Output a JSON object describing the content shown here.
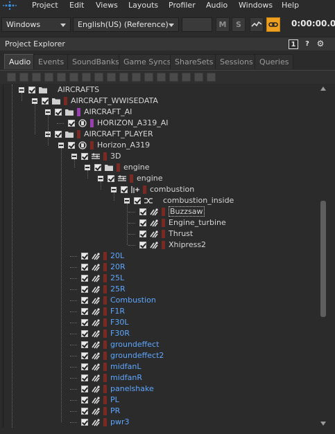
{
  "menu": {
    "items": [
      "Project",
      "Edit",
      "Views",
      "Layouts",
      "Profiler",
      "Audio",
      "Windows",
      "Help"
    ]
  },
  "toolbar": {
    "layout_value": "Windows",
    "language_value": "English(US) (Reference)",
    "mute_label": "M",
    "solo_label": "S",
    "timecode": "0:00:00.0"
  },
  "panel": {
    "title": "Project Explorer",
    "index_label": "1",
    "help_label": "?",
    "settings_label": "⚙"
  },
  "tabs": [
    "Audio",
    "Events",
    "SoundBanks",
    "Game Syncs",
    "ShareSets",
    "Sessions",
    "Queries"
  ],
  "active_tab": "Audio",
  "colors": {
    "accent_orange": "#f0a020",
    "bar_red": "#7a2a22",
    "bar_purple": "#9a3fb0",
    "link_blue": "#5ea7ff"
  },
  "tree": [
    {
      "label": "AIRCRAFTS",
      "icon": "folder-icon",
      "bar": "none",
      "depth": 0,
      "expander": true,
      "blue": false
    },
    {
      "label": "AIRCRAFT_WWISEDATA",
      "icon": "folder-icon",
      "bar": "red",
      "depth": 1,
      "expander": true,
      "blue": false
    },
    {
      "label": "AIRCRAFT_AI",
      "icon": "folder-icon",
      "bar": "purple",
      "depth": 2,
      "expander": true,
      "blue": false
    },
    {
      "label": "HORIZON_A319_AI",
      "icon": "actor-mixer-icon",
      "bar": "purple",
      "depth": 3,
      "expander": false,
      "blue": false
    },
    {
      "label": "AIRCRAFT_PLAYER",
      "icon": "folder-icon",
      "bar": "red",
      "depth": 2,
      "expander": true,
      "blue": false
    },
    {
      "label": "Horizon_A319",
      "icon": "actor-mixer-icon",
      "bar": "red",
      "depth": 3,
      "expander": true,
      "blue": false
    },
    {
      "label": "3D",
      "icon": "blend-container-icon",
      "bar": "red",
      "depth": 4,
      "expander": true,
      "blue": false
    },
    {
      "label": "engine",
      "icon": "folder-icon",
      "bar": "red",
      "depth": 5,
      "expander": true,
      "blue": false
    },
    {
      "label": "engine",
      "icon": "blend-container-icon",
      "bar": "red",
      "depth": 6,
      "expander": true,
      "blue": false
    },
    {
      "label": "combustion",
      "icon": "switch-container-icon",
      "bar": "red",
      "depth": 7,
      "expander": true,
      "blue": false
    },
    {
      "label": "combustion_inside",
      "icon": "random-container-icon",
      "bar": "none",
      "depth": 8,
      "expander": true,
      "blue": false
    },
    {
      "label": "Buzzsaw",
      "icon": "sound-sfx-icon",
      "bar": "red",
      "depth": 9,
      "expander": false,
      "blue": false,
      "selected": true
    },
    {
      "label": "Engine_turbine",
      "icon": "sound-sfx-icon",
      "bar": "red",
      "depth": 9,
      "expander": false,
      "blue": false
    },
    {
      "label": "Thrust",
      "icon": "sound-sfx-icon",
      "bar": "red",
      "depth": 9,
      "expander": false,
      "blue": false
    },
    {
      "label": "Xhipress2",
      "icon": "sound-sfx-icon",
      "bar": "red",
      "depth": 9,
      "expander": false,
      "blue": false
    },
    {
      "label": "20L",
      "icon": "sound-sfx-icon",
      "bar": "red",
      "depth": 4,
      "expander": false,
      "blue": true
    },
    {
      "label": "20R",
      "icon": "sound-sfx-icon",
      "bar": "red",
      "depth": 4,
      "expander": false,
      "blue": true
    },
    {
      "label": "25L",
      "icon": "sound-sfx-icon",
      "bar": "red",
      "depth": 4,
      "expander": false,
      "blue": true
    },
    {
      "label": "25R",
      "icon": "sound-sfx-icon",
      "bar": "red",
      "depth": 4,
      "expander": false,
      "blue": true
    },
    {
      "label": "Combustion",
      "icon": "sound-sfx-icon",
      "bar": "red",
      "depth": 4,
      "expander": false,
      "blue": true
    },
    {
      "label": "F1R",
      "icon": "sound-sfx-icon",
      "bar": "red",
      "depth": 4,
      "expander": false,
      "blue": true
    },
    {
      "label": "F30L",
      "icon": "sound-sfx-icon",
      "bar": "red",
      "depth": 4,
      "expander": false,
      "blue": true
    },
    {
      "label": "F30R",
      "icon": "sound-sfx-icon",
      "bar": "red",
      "depth": 4,
      "expander": false,
      "blue": true
    },
    {
      "label": "groundeffect",
      "icon": "sound-sfx-icon",
      "bar": "red",
      "depth": 4,
      "expander": false,
      "blue": true
    },
    {
      "label": "groundeffect2",
      "icon": "sound-sfx-icon",
      "bar": "red",
      "depth": 4,
      "expander": false,
      "blue": true
    },
    {
      "label": "midfanL",
      "icon": "sound-sfx-icon",
      "bar": "red",
      "depth": 4,
      "expander": false,
      "blue": true
    },
    {
      "label": "midfanR",
      "icon": "sound-sfx-icon",
      "bar": "red",
      "depth": 4,
      "expander": false,
      "blue": true
    },
    {
      "label": "panelshake",
      "icon": "sound-sfx-icon",
      "bar": "red",
      "depth": 4,
      "expander": false,
      "blue": true
    },
    {
      "label": "PL",
      "icon": "sound-sfx-icon",
      "bar": "red",
      "depth": 4,
      "expander": false,
      "blue": true
    },
    {
      "label": "PR",
      "icon": "sound-sfx-icon",
      "bar": "red",
      "depth": 4,
      "expander": false,
      "blue": true
    },
    {
      "label": "pwr3",
      "icon": "sound-sfx-icon",
      "bar": "red",
      "depth": 4,
      "expander": false,
      "blue": true
    }
  ]
}
